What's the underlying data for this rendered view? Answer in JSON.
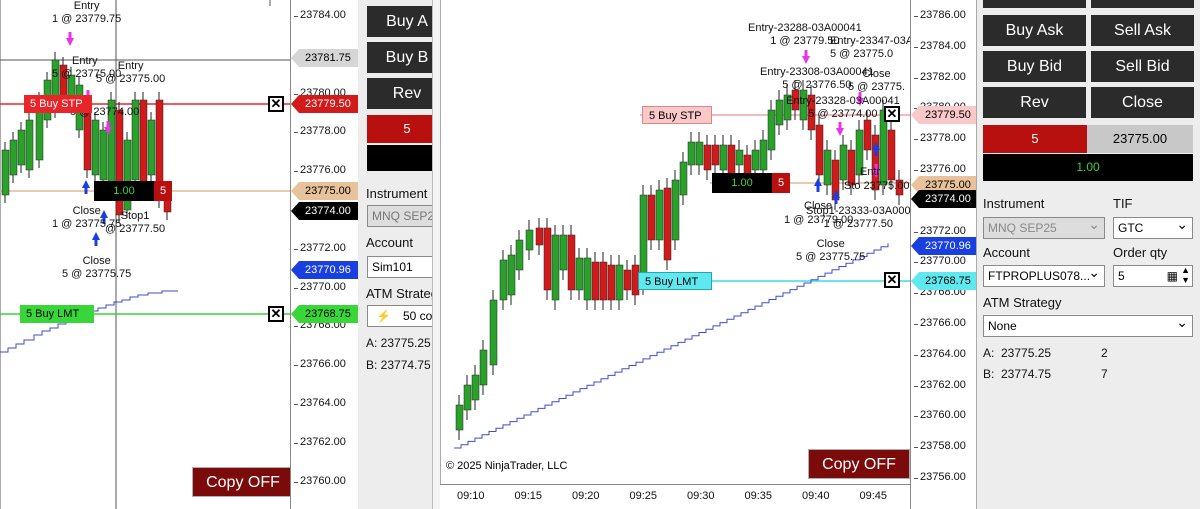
{
  "left_window": {
    "price_axis": [
      "23784.00",
      "23782.00",
      "23780.00",
      "23778.00",
      "23776.00",
      "23774.00",
      "23772.00",
      "23770.00",
      "23768.00",
      "23766.00",
      "23764.00",
      "23762.00",
      "23760.00"
    ],
    "price_tags": {
      "p1": "23781.75",
      "p2": "23779.50",
      "p3": "23775.00",
      "p4": "23774.00",
      "p5": "23770.96",
      "p6": "23768.75"
    },
    "stp_order": {
      "label": "5  Buy STP"
    },
    "lmt_order": {
      "label": "5  Buy LMT"
    },
    "position": {
      "qty": "1.00",
      "count": "5"
    },
    "annotations": {
      "a1": "Entry\n1 @ 23779.75",
      "a2": "Entry",
      "a3": "5 @ 23775.00",
      "a4": "Entry\n5 @ 23775.00",
      "a5": "5 @ 23774.00",
      "a6": "Close\n1 @ 23775.75",
      "a7": "Stop1\n@ 23777.50",
      "a8": "Close\n5 @ 23775.75"
    },
    "copy_label": "Copy OFF"
  },
  "left_panel": {
    "buttons": [
      "Buy A",
      "Buy B",
      "Rev"
    ],
    "position_qty": "5",
    "instrument_label": "Instrument",
    "instrument_value": "MNQ SEP2",
    "account_label": "Account",
    "account_value": "Sim101",
    "atm_label": "ATM Strateg",
    "atm_value": "50 co",
    "ask_row": "A:  23775.25",
    "bid_row": "B:  23774.75"
  },
  "right_window": {
    "price_axis": [
      "23786.00",
      "23784.00",
      "23782.00",
      "23780.00",
      "23778.00",
      "23776.00",
      "23774.00",
      "23772.00",
      "23770.00",
      "23768.00",
      "23766.00",
      "23764.00",
      "23762.00",
      "23760.00",
      "23758.00",
      "23756.00"
    ],
    "price_tags": {
      "p1": "23779.50",
      "p2": "23775.00",
      "p3": "23774.00",
      "p4": "23770.96",
      "p5": "23768.75"
    },
    "time_axis": [
      "09:10",
      "09:15",
      "09:20",
      "09:25",
      "09:30",
      "09:35",
      "09:40",
      "09:45"
    ],
    "stp_order": {
      "label": "5  Buy STP"
    },
    "lmt_order": {
      "label": "5  Buy LMT"
    },
    "position": {
      "qty": "1.00",
      "count": "5"
    },
    "annotations": {
      "b1": "Entry-23288-03A00041\n1 @ 23779.50",
      "b2": "Entry-23347-03A\n5 @ 23775.0",
      "b3": "Entry-23308-03A00041\n5 @ 23776.50",
      "b4": "Close\n5 @ 23775.",
      "b5": "Entry-23328-03A00041\n5 @ 23774.00",
      "b6": "Entr",
      "b7": "Sto 23775.00",
      "b8": "Close",
      "b9": "Stop1-23333-03A000\n1 @ 23777.50",
      "b10": "1 @ 23779.00",
      "b11": "Close\n5 @ 23775.75"
    },
    "copyright": "© 2025 NinjaTrader, LLC",
    "copy_label": "Copy OFF"
  },
  "right_panel": {
    "buy_ask": "Buy Ask",
    "sell_ask": "Sell Ask",
    "buy_bid": "Buy Bid",
    "sell_bid": "Sell Bid",
    "rev": "Rev",
    "close": "Close",
    "pos_qty": "5",
    "pos_price": "23775.00",
    "pnl": "1.00",
    "instrument_label": "Instrument",
    "tif_label": "TIF",
    "instrument_value": "MNQ SEP25",
    "tif_value": "GTC",
    "account_label": "Account",
    "order_qty_label": "Order qty",
    "account_value": "FTPROPLUS078...",
    "order_qty_value": "5",
    "atm_label": "ATM Strategy",
    "atm_value": "None",
    "ask_label": "A:",
    "ask_price": "23775.25",
    "ask_size": "2",
    "bid_label": "B:",
    "bid_price": "23774.75",
    "bid_size": "7"
  },
  "colors": {
    "up": "#2aa12a",
    "down": "#d11a1a",
    "stp": "#e8262a",
    "lmt": "#39d639",
    "tag_blue": "#1a3fe0",
    "tag_tan": "#e8c29a",
    "dark": "#2b2b2b",
    "copy": "#7b0b0b"
  }
}
